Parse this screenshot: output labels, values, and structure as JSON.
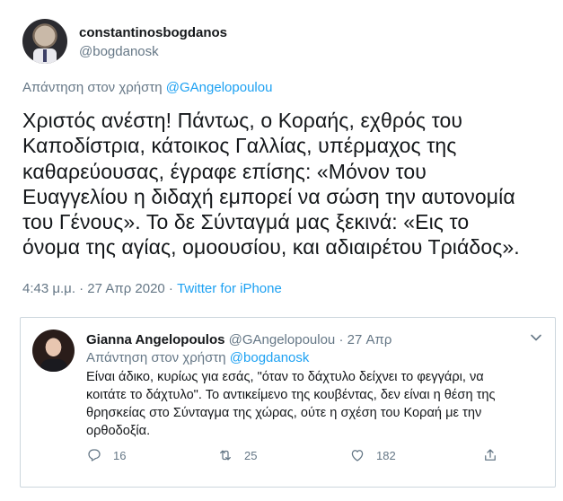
{
  "main": {
    "display_name": "constantinosbogdanos",
    "handle": "@bogdanosk",
    "reply_prefix": "Απάντηση στον χρήστη",
    "reply_mention": "@GAngelopoulou",
    "text_lines": [
      "Χριστός ανέστη! Πάντως, ο Κοραής, εχθρός του",
      "Καποδίστρια, κάτοικος Γαλλίας, υπέρμαχος της",
      "καθαρεύουσας, έγραφε επίσης: «Μόνον του",
      "Ευαγγελίου η διδαχή εμπορεί να σώση την αυτονομία",
      "του Γένους». Το δε Σύνταγμά μας ξεκινά: «Εις το",
      "όνομα της αγίας, ομοουσίου, και αδιαιρέτου Τριάδος»."
    ],
    "timestamp": "4:43 μ.μ. · 27 Απρ 2020 · ",
    "source": "Twitter for iPhone"
  },
  "reply": {
    "display_name": "Gianna Angelopoulos",
    "handle": "@GAngelopoulou",
    "separator": " · ",
    "date": "27 Απρ",
    "reply_prefix": "Απάντηση στον χρήστη",
    "reply_mention": "@bogdanosk",
    "text_lines": [
      "Είναι άδικο, κυρίως για εσάς, \"όταν το δάχτυλο δείχνει το φεγγάρι, να",
      "κοιτάτε το δάχτυλο\". Το αντικείμενο της κουβέντας, δεν είναι η θέση της",
      "θρησκείας στο Σύνταγμα της χώρας, ούτε η σχέση του Κοραή με την",
      "ορθοδοξία."
    ],
    "actions": {
      "replies": "16",
      "retweets": "25",
      "likes": "182"
    }
  },
  "colors": {
    "accent": "#1da1f2",
    "secondary_text": "#657786",
    "primary_text": "#14171a",
    "border": "#ccd6dd"
  },
  "icons": [
    "caret-down-icon",
    "reply-icon",
    "retweet-icon",
    "like-icon",
    "share-icon"
  ]
}
